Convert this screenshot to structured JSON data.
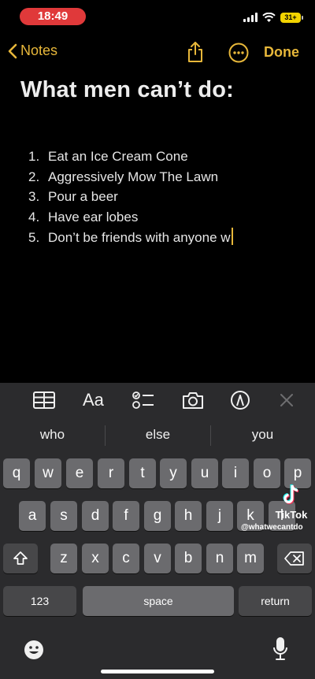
{
  "status_bar": {
    "time": "18:49",
    "battery": "31+"
  },
  "nav": {
    "back_label": "Notes",
    "done_label": "Done"
  },
  "note": {
    "title": "What men can’t do:",
    "items": [
      {
        "num": "1.",
        "text": "Eat an Ice Cream Cone"
      },
      {
        "num": "2.",
        "text": "Aggressively Mow The Lawn"
      },
      {
        "num": "3.",
        "text": "Pour a beer"
      },
      {
        "num": "4.",
        "text": "Have ear lobes"
      },
      {
        "num": "5.",
        "text": "Don’t be friends with anyone w"
      }
    ]
  },
  "toolbar": {
    "format_label": "Aa"
  },
  "predictions": [
    "who",
    "else",
    "you"
  ],
  "keyboard": {
    "row1": [
      "q",
      "w",
      "e",
      "r",
      "t",
      "y",
      "u",
      "i",
      "o",
      "p"
    ],
    "row2": [
      "a",
      "s",
      "d",
      "f",
      "g",
      "h",
      "j",
      "k",
      "l"
    ],
    "row3": [
      "z",
      "x",
      "c",
      "v",
      "b",
      "n",
      "m"
    ],
    "numbers_label": "123",
    "space_label": "space",
    "return_label": "return"
  },
  "watermark": {
    "brand": "TikTok",
    "user": "@whatwecantdo"
  },
  "colors": {
    "accent": "#e7b73a",
    "time_pill": "#e0393a",
    "keyboard_bg": "#2b2b2d"
  }
}
